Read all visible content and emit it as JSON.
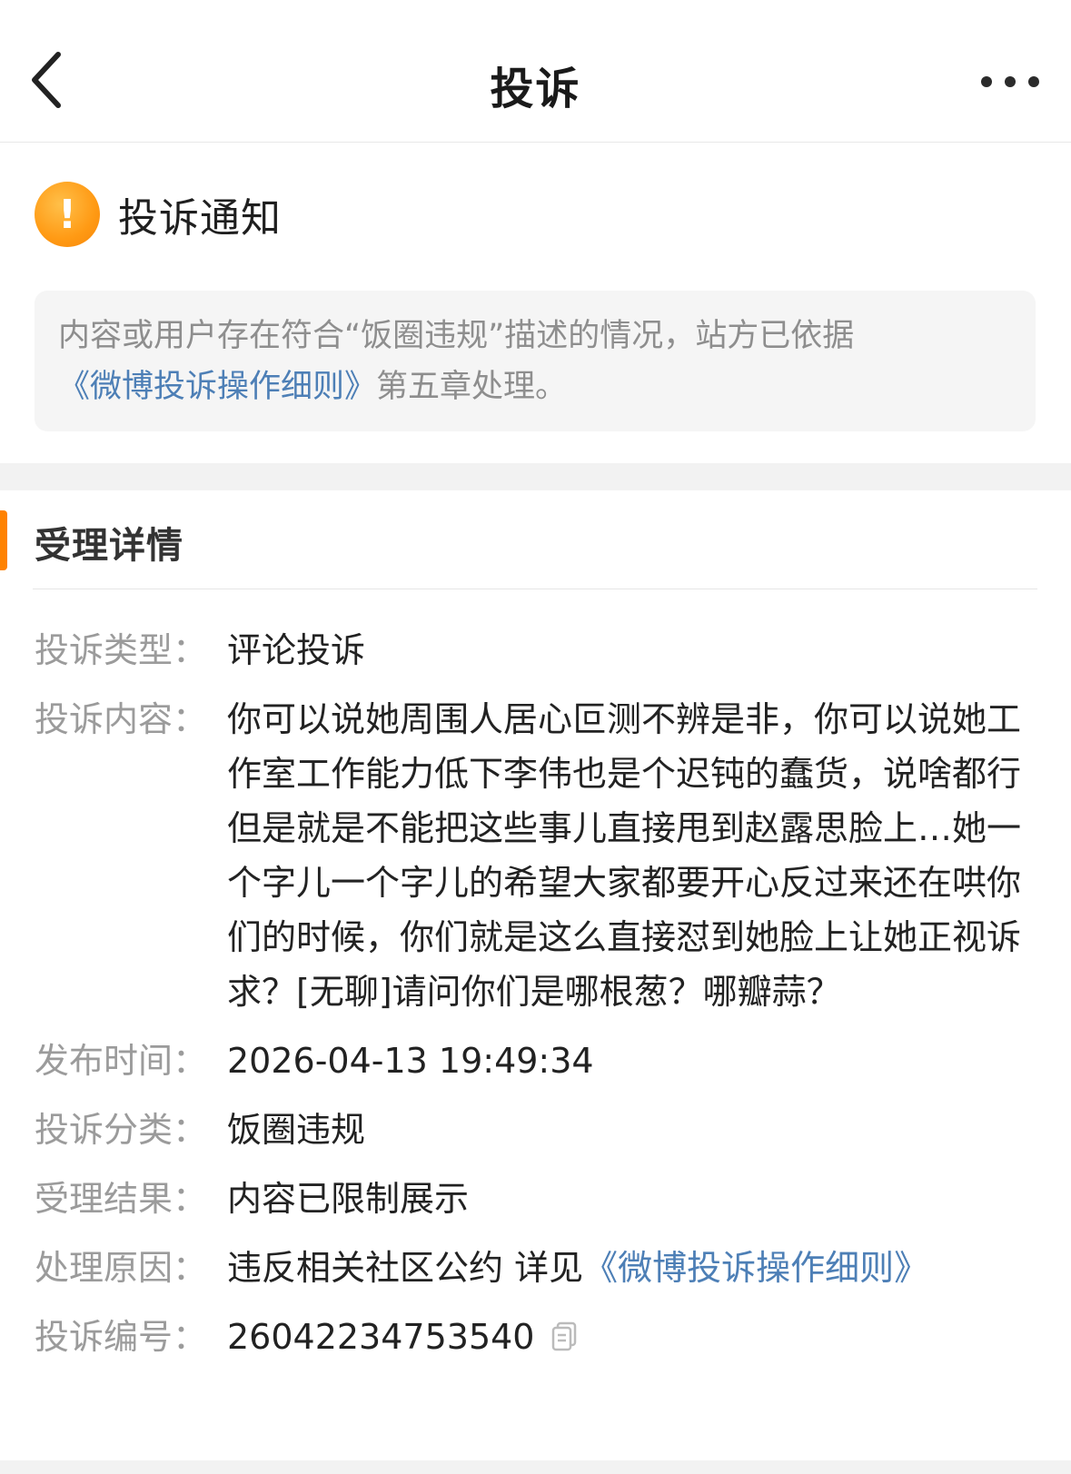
{
  "header": {
    "title": "投诉"
  },
  "notice": {
    "icon_symbol": "!",
    "title": "投诉通知",
    "text_prefix": "内容或用户存在符合“饭圈违规”描述的情况，站方已依据",
    "link": "《微博投诉操作细则》",
    "text_suffix": "第五章处理。"
  },
  "details": {
    "section_title": "受理详情",
    "rows": [
      {
        "label": "投诉类型：",
        "value": "评论投诉"
      },
      {
        "label": "投诉内容：",
        "value": "你可以说她周围人居心叵测不辨是非，你可以说她工作室工作能力低下李伟也是个迟钝的蠢货，说啥都行但是就是不能把这些事儿直接甩到赵露思脸上…她一个字儿一个字儿的希望大家都要开心反过来还在哄你们的时候，你们就是这么直接怼到她脸上让她正视诉求？[无聊]请问你们是哪根葱？哪瓣蒜？"
      },
      {
        "label": "发布时间：",
        "value": "2026-04-13 19:49:34"
      },
      {
        "label": "投诉分类：",
        "value": "饭圈违规"
      },
      {
        "label": "受理结果：",
        "value": "内容已限制展示"
      },
      {
        "label": "处理原因：",
        "value": "违反相关社区公约 详见",
        "link": "《微博投诉操作细则》"
      },
      {
        "label": "投诉编号：",
        "value": "26042234753540"
      }
    ]
  },
  "colors": {
    "accent_orange": "#ff8200",
    "link_blue": "#4d7fb6",
    "label_gray": "#9b9b9b"
  },
  "icons": [
    "back-chevron-icon",
    "more-dots-icon",
    "warning-icon",
    "copy-icon"
  ]
}
